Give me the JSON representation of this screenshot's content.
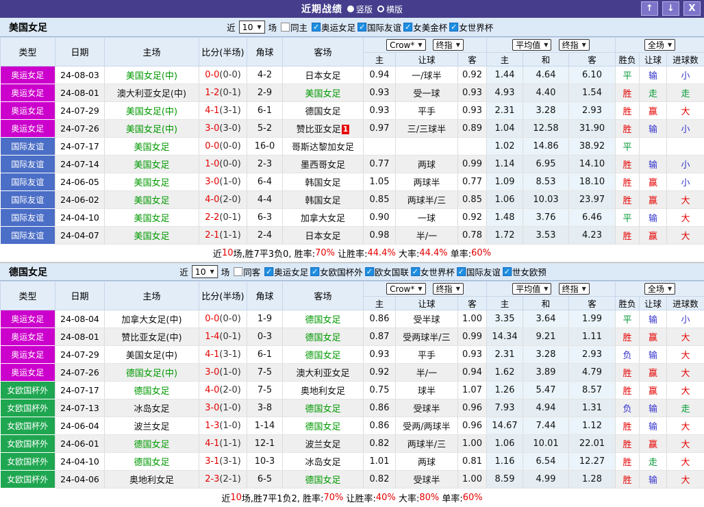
{
  "titlebar": {
    "title": "近期战绩",
    "layout_options": [
      {
        "label": "竖版",
        "selected": true
      },
      {
        "label": "横版",
        "selected": false
      }
    ],
    "buttons": {
      "up_glyph": "↑",
      "down_glyph": "↓",
      "close_glyph": "X"
    }
  },
  "columns": {
    "type": "类型",
    "date": "日期",
    "home": "主场",
    "score": "比分(半场)",
    "corner": "角球",
    "away": "客场",
    "asia_home": "主",
    "asia_handicap": "让球",
    "asia_away": "客",
    "euro_home": "主",
    "euro_draw": "和",
    "euro_away": "客",
    "result": "胜负",
    "handicap_result": "让球",
    "goals": "进球数"
  },
  "colors": {
    "red": "#e60000",
    "green": "#009933",
    "blue": "#3333cc",
    "league_magenta": "#cc00cc",
    "league_blue": "#4b6ec6",
    "league_green": "#1fa650",
    "accent_titlebar": "#463e8c",
    "highlight_team": "#009900"
  },
  "sections": [
    {
      "team": "美国女足",
      "filter": {
        "prefix": "近",
        "count": "10",
        "suffix": "场",
        "same_label": "同主",
        "same_checked": false,
        "leagues": [
          "奥运女足",
          "国际友谊",
          "女美金杯",
          "女世界杯"
        ]
      },
      "dropdowns": {
        "asia_company": "Crow*",
        "asia_period": "终指",
        "euro_source": "平均值",
        "euro_period": "终指",
        "scope": "全场"
      },
      "rows": [
        {
          "league": "奥运女足",
          "league_color": "magenta",
          "date": "24-08-03",
          "home": "美国女足(中)",
          "home_highlight": 1,
          "score": "0-0",
          "half": "(0-0)",
          "corner": "4-2",
          "away": "日本女足",
          "away_highlight": 0,
          "away_badge": "",
          "odds_home": "0.94",
          "handicap": "一/球半",
          "odds_away": "0.92",
          "avg_home": "1.44",
          "avg_draw": "4.64",
          "avg_away": "6.10",
          "result": {
            "t": "平",
            "c": "green"
          },
          "let_result": {
            "t": "输",
            "c": "blue"
          },
          "goal_result": {
            "t": "小",
            "c": "blue"
          }
        },
        {
          "league": "奥运女足",
          "league_color": "magenta",
          "date": "24-08-01",
          "home": "澳大利亚女足(中)",
          "home_highlight": 0,
          "score": "1-2",
          "half": "(0-1)",
          "corner": "2-9",
          "away": "美国女足",
          "away_highlight": 1,
          "away_badge": "",
          "odds_home": "0.93",
          "handicap": "受一球",
          "odds_away": "0.93",
          "avg_home": "4.93",
          "avg_draw": "4.40",
          "avg_away": "1.54",
          "result": {
            "t": "胜",
            "c": "red"
          },
          "let_result": {
            "t": "走",
            "c": "green"
          },
          "goal_result": {
            "t": "走",
            "c": "green"
          }
        },
        {
          "league": "奥运女足",
          "league_color": "magenta",
          "date": "24-07-29",
          "home": "美国女足(中)",
          "home_highlight": 1,
          "score": "4-1",
          "half": "(3-1)",
          "corner": "6-1",
          "away": "德国女足",
          "away_highlight": 0,
          "away_badge": "",
          "odds_home": "0.93",
          "handicap": "平手",
          "odds_away": "0.93",
          "avg_home": "2.31",
          "avg_draw": "3.28",
          "avg_away": "2.93",
          "result": {
            "t": "胜",
            "c": "red"
          },
          "let_result": {
            "t": "赢",
            "c": "red"
          },
          "goal_result": {
            "t": "大",
            "c": "red"
          }
        },
        {
          "league": "奥运女足",
          "league_color": "magenta",
          "date": "24-07-26",
          "home": "美国女足(中)",
          "home_highlight": 1,
          "score": "3-0",
          "half": "(3-0)",
          "corner": "5-2",
          "away": "赞比亚女足",
          "away_highlight": 0,
          "away_badge": "1",
          "odds_home": "0.97",
          "handicap": "三/三球半",
          "odds_away": "0.89",
          "avg_home": "1.04",
          "avg_draw": "12.58",
          "avg_away": "31.90",
          "result": {
            "t": "胜",
            "c": "red"
          },
          "let_result": {
            "t": "输",
            "c": "blue"
          },
          "goal_result": {
            "t": "小",
            "c": "blue"
          }
        },
        {
          "league": "国际友谊",
          "league_color": "blue",
          "date": "24-07-17",
          "home": "美国女足",
          "home_highlight": 1,
          "score": "0-0",
          "half": "(0-0)",
          "corner": "16-0",
          "away": "哥斯达黎加女足",
          "away_highlight": 0,
          "away_badge": "",
          "odds_home": "",
          "handicap": "",
          "odds_away": "",
          "avg_home": "1.02",
          "avg_draw": "14.86",
          "avg_away": "38.92",
          "result": {
            "t": "平",
            "c": "green"
          },
          "let_result": {
            "t": "",
            "c": ""
          },
          "goal_result": {
            "t": "",
            "c": ""
          }
        },
        {
          "league": "国际友谊",
          "league_color": "blue",
          "date": "24-07-14",
          "home": "美国女足",
          "home_highlight": 1,
          "score": "1-0",
          "half": "(0-0)",
          "corner": "2-3",
          "away": "墨西哥女足",
          "away_highlight": 0,
          "away_badge": "",
          "odds_home": "0.77",
          "handicap": "两球",
          "odds_away": "0.99",
          "avg_home": "1.14",
          "avg_draw": "6.95",
          "avg_away": "14.10",
          "result": {
            "t": "胜",
            "c": "red"
          },
          "let_result": {
            "t": "输",
            "c": "blue"
          },
          "goal_result": {
            "t": "小",
            "c": "blue"
          }
        },
        {
          "league": "国际友谊",
          "league_color": "blue",
          "date": "24-06-05",
          "home": "美国女足",
          "home_highlight": 1,
          "score": "3-0",
          "half": "(1-0)",
          "corner": "6-4",
          "away": "韩国女足",
          "away_highlight": 0,
          "away_badge": "",
          "odds_home": "1.05",
          "handicap": "两球半",
          "odds_away": "0.77",
          "avg_home": "1.09",
          "avg_draw": "8.53",
          "avg_away": "18.10",
          "result": {
            "t": "胜",
            "c": "red"
          },
          "let_result": {
            "t": "赢",
            "c": "red"
          },
          "goal_result": {
            "t": "小",
            "c": "blue"
          }
        },
        {
          "league": "国际友谊",
          "league_color": "blue",
          "date": "24-06-02",
          "home": "美国女足",
          "home_highlight": 1,
          "score": "4-0",
          "half": "(2-0)",
          "corner": "4-4",
          "away": "韩国女足",
          "away_highlight": 0,
          "away_badge": "",
          "odds_home": "0.85",
          "handicap": "两球半/三",
          "odds_away": "0.85",
          "avg_home": "1.06",
          "avg_draw": "10.03",
          "avg_away": "23.97",
          "result": {
            "t": "胜",
            "c": "red"
          },
          "let_result": {
            "t": "赢",
            "c": "red"
          },
          "goal_result": {
            "t": "大",
            "c": "red"
          }
        },
        {
          "league": "国际友谊",
          "league_color": "blue",
          "date": "24-04-10",
          "home": "美国女足",
          "home_highlight": 1,
          "score": "2-2",
          "half": "(0-1)",
          "corner": "6-3",
          "away": "加拿大女足",
          "away_highlight": 0,
          "away_badge": "",
          "odds_home": "0.90",
          "handicap": "一球",
          "odds_away": "0.92",
          "avg_home": "1.48",
          "avg_draw": "3.76",
          "avg_away": "6.46",
          "result": {
            "t": "平",
            "c": "green"
          },
          "let_result": {
            "t": "输",
            "c": "blue"
          },
          "goal_result": {
            "t": "大",
            "c": "red"
          }
        },
        {
          "league": "国际友谊",
          "league_color": "blue",
          "date": "24-04-07",
          "home": "美国女足",
          "home_highlight": 1,
          "score": "2-1",
          "half": "(1-1)",
          "corner": "2-4",
          "away": "日本女足",
          "away_highlight": 0,
          "away_badge": "",
          "odds_home": "0.98",
          "handicap": "半/一",
          "odds_away": "0.78",
          "avg_home": "1.72",
          "avg_draw": "3.53",
          "avg_away": "4.23",
          "result": {
            "t": "胜",
            "c": "red"
          },
          "let_result": {
            "t": "赢",
            "c": "red"
          },
          "goal_result": {
            "t": "大",
            "c": "red"
          }
        }
      ],
      "summary": [
        {
          "t": "近",
          "c": "k"
        },
        {
          "t": "10",
          "c": "r"
        },
        {
          "t": "场,胜7平3负0, 胜率:",
          "c": "k"
        },
        {
          "t": "70%",
          "c": "r"
        },
        {
          "t": " 让胜率:",
          "c": "k"
        },
        {
          "t": "44.4%",
          "c": "r"
        },
        {
          "t": " 大率:",
          "c": "k"
        },
        {
          "t": "44.4%",
          "c": "r"
        },
        {
          "t": " 单率:",
          "c": "k"
        },
        {
          "t": "60%",
          "c": "r"
        }
      ]
    },
    {
      "team": "德国女足",
      "filter": {
        "prefix": "近",
        "count": "10",
        "suffix": "场",
        "same_label": "同客",
        "same_checked": false,
        "leagues": [
          "奥运女足",
          "女欧国杯外",
          "欧女国联",
          "女世界杯",
          "国际友谊",
          "世女欧预"
        ]
      },
      "dropdowns": {
        "asia_company": "Crow*",
        "asia_period": "终指",
        "euro_source": "平均值",
        "euro_period": "终指",
        "scope": "全场"
      },
      "rows": [
        {
          "league": "奥运女足",
          "league_color": "magenta",
          "date": "24-08-04",
          "home": "加拿大女足(中)",
          "home_highlight": 0,
          "score": "0-0",
          "half": "(0-0)",
          "corner": "1-9",
          "away": "德国女足",
          "away_highlight": 1,
          "away_badge": "",
          "odds_home": "0.86",
          "handicap": "受半球",
          "odds_away": "1.00",
          "avg_home": "3.35",
          "avg_draw": "3.64",
          "avg_away": "1.99",
          "result": {
            "t": "平",
            "c": "green"
          },
          "let_result": {
            "t": "输",
            "c": "blue"
          },
          "goal_result": {
            "t": "小",
            "c": "blue"
          }
        },
        {
          "league": "奥运女足",
          "league_color": "magenta",
          "date": "24-08-01",
          "home": "赞比亚女足(中)",
          "home_highlight": 0,
          "score": "1-4",
          "half": "(0-1)",
          "corner": "0-3",
          "away": "德国女足",
          "away_highlight": 1,
          "away_badge": "",
          "odds_home": "0.87",
          "handicap": "受两球半/三",
          "odds_away": "0.99",
          "avg_home": "14.34",
          "avg_draw": "9.21",
          "avg_away": "1.11",
          "result": {
            "t": "胜",
            "c": "red"
          },
          "let_result": {
            "t": "赢",
            "c": "red"
          },
          "goal_result": {
            "t": "大",
            "c": "red"
          }
        },
        {
          "league": "奥运女足",
          "league_color": "magenta",
          "date": "24-07-29",
          "home": "美国女足(中)",
          "home_highlight": 0,
          "score": "4-1",
          "half": "(3-1)",
          "corner": "6-1",
          "away": "德国女足",
          "away_highlight": 1,
          "away_badge": "",
          "odds_home": "0.93",
          "handicap": "平手",
          "odds_away": "0.93",
          "avg_home": "2.31",
          "avg_draw": "3.28",
          "avg_away": "2.93",
          "result": {
            "t": "负",
            "c": "blue"
          },
          "let_result": {
            "t": "输",
            "c": "blue"
          },
          "goal_result": {
            "t": "大",
            "c": "red"
          }
        },
        {
          "league": "奥运女足",
          "league_color": "magenta",
          "date": "24-07-26",
          "home": "德国女足(中)",
          "home_highlight": 1,
          "score": "3-0",
          "half": "(1-0)",
          "corner": "7-5",
          "away": "澳大利亚女足",
          "away_highlight": 0,
          "away_badge": "",
          "odds_home": "0.92",
          "handicap": "半/一",
          "odds_away": "0.94",
          "avg_home": "1.62",
          "avg_draw": "3.89",
          "avg_away": "4.79",
          "result": {
            "t": "胜",
            "c": "red"
          },
          "let_result": {
            "t": "赢",
            "c": "red"
          },
          "goal_result": {
            "t": "大",
            "c": "red"
          }
        },
        {
          "league": "女欧国杯外",
          "league_color": "green",
          "date": "24-07-17",
          "home": "德国女足",
          "home_highlight": 1,
          "score": "4-0",
          "half": "(2-0)",
          "corner": "7-5",
          "away": "奥地利女足",
          "away_highlight": 0,
          "away_badge": "",
          "odds_home": "0.75",
          "handicap": "球半",
          "odds_away": "1.07",
          "avg_home": "1.26",
          "avg_draw": "5.47",
          "avg_away": "8.57",
          "result": {
            "t": "胜",
            "c": "red"
          },
          "let_result": {
            "t": "赢",
            "c": "red"
          },
          "goal_result": {
            "t": "大",
            "c": "red"
          }
        },
        {
          "league": "女欧国杯外",
          "league_color": "green",
          "date": "24-07-13",
          "home": "冰岛女足",
          "home_highlight": 0,
          "score": "3-0",
          "half": "(1-0)",
          "corner": "3-8",
          "away": "德国女足",
          "away_highlight": 1,
          "away_badge": "",
          "odds_home": "0.86",
          "handicap": "受球半",
          "odds_away": "0.96",
          "avg_home": "7.93",
          "avg_draw": "4.94",
          "avg_away": "1.31",
          "result": {
            "t": "负",
            "c": "blue"
          },
          "let_result": {
            "t": "输",
            "c": "blue"
          },
          "goal_result": {
            "t": "走",
            "c": "green"
          }
        },
        {
          "league": "女欧国杯外",
          "league_color": "green",
          "date": "24-06-04",
          "home": "波兰女足",
          "home_highlight": 0,
          "score": "1-3",
          "half": "(1-0)",
          "corner": "1-14",
          "away": "德国女足",
          "away_highlight": 1,
          "away_badge": "",
          "odds_home": "0.86",
          "handicap": "受两/两球半",
          "odds_away": "0.96",
          "avg_home": "14.67",
          "avg_draw": "7.44",
          "avg_away": "1.12",
          "result": {
            "t": "胜",
            "c": "red"
          },
          "let_result": {
            "t": "输",
            "c": "blue"
          },
          "goal_result": {
            "t": "大",
            "c": "red"
          }
        },
        {
          "league": "女欧国杯外",
          "league_color": "green",
          "date": "24-06-01",
          "home": "德国女足",
          "home_highlight": 1,
          "score": "4-1",
          "half": "(1-1)",
          "corner": "12-1",
          "away": "波兰女足",
          "away_highlight": 0,
          "away_badge": "",
          "odds_home": "0.82",
          "handicap": "两球半/三",
          "odds_away": "1.00",
          "avg_home": "1.06",
          "avg_draw": "10.01",
          "avg_away": "22.01",
          "result": {
            "t": "胜",
            "c": "red"
          },
          "let_result": {
            "t": "赢",
            "c": "red"
          },
          "goal_result": {
            "t": "大",
            "c": "red"
          }
        },
        {
          "league": "女欧国杯外",
          "league_color": "green",
          "date": "24-04-10",
          "home": "德国女足",
          "home_highlight": 1,
          "score": "3-1",
          "half": "(3-1)",
          "corner": "10-3",
          "away": "冰岛女足",
          "away_highlight": 0,
          "away_badge": "",
          "odds_home": "1.01",
          "handicap": "两球",
          "odds_away": "0.81",
          "avg_home": "1.16",
          "avg_draw": "6.54",
          "avg_away": "12.27",
          "result": {
            "t": "胜",
            "c": "red"
          },
          "let_result": {
            "t": "走",
            "c": "green"
          },
          "goal_result": {
            "t": "大",
            "c": "red"
          }
        },
        {
          "league": "女欧国杯外",
          "league_color": "green",
          "date": "24-04-06",
          "home": "奥地利女足",
          "home_highlight": 0,
          "score": "2-3",
          "half": "(2-1)",
          "corner": "6-5",
          "away": "德国女足",
          "away_highlight": 1,
          "away_badge": "",
          "odds_home": "0.82",
          "handicap": "受球半",
          "odds_away": "1.00",
          "avg_home": "8.59",
          "avg_draw": "4.99",
          "avg_away": "1.28",
          "result": {
            "t": "胜",
            "c": "red"
          },
          "let_result": {
            "t": "输",
            "c": "blue"
          },
          "goal_result": {
            "t": "大",
            "c": "red"
          }
        }
      ],
      "summary": [
        {
          "t": "近",
          "c": "k"
        },
        {
          "t": "10",
          "c": "r"
        },
        {
          "t": "场,胜7平1负2, 胜率:",
          "c": "k"
        },
        {
          "t": "70%",
          "c": "r"
        },
        {
          "t": " 让胜率:",
          "c": "k"
        },
        {
          "t": "40%",
          "c": "r"
        },
        {
          "t": " 大率:",
          "c": "k"
        },
        {
          "t": "80%",
          "c": "r"
        },
        {
          "t": " 单率:",
          "c": "k"
        },
        {
          "t": "60%",
          "c": "r"
        }
      ]
    }
  ]
}
